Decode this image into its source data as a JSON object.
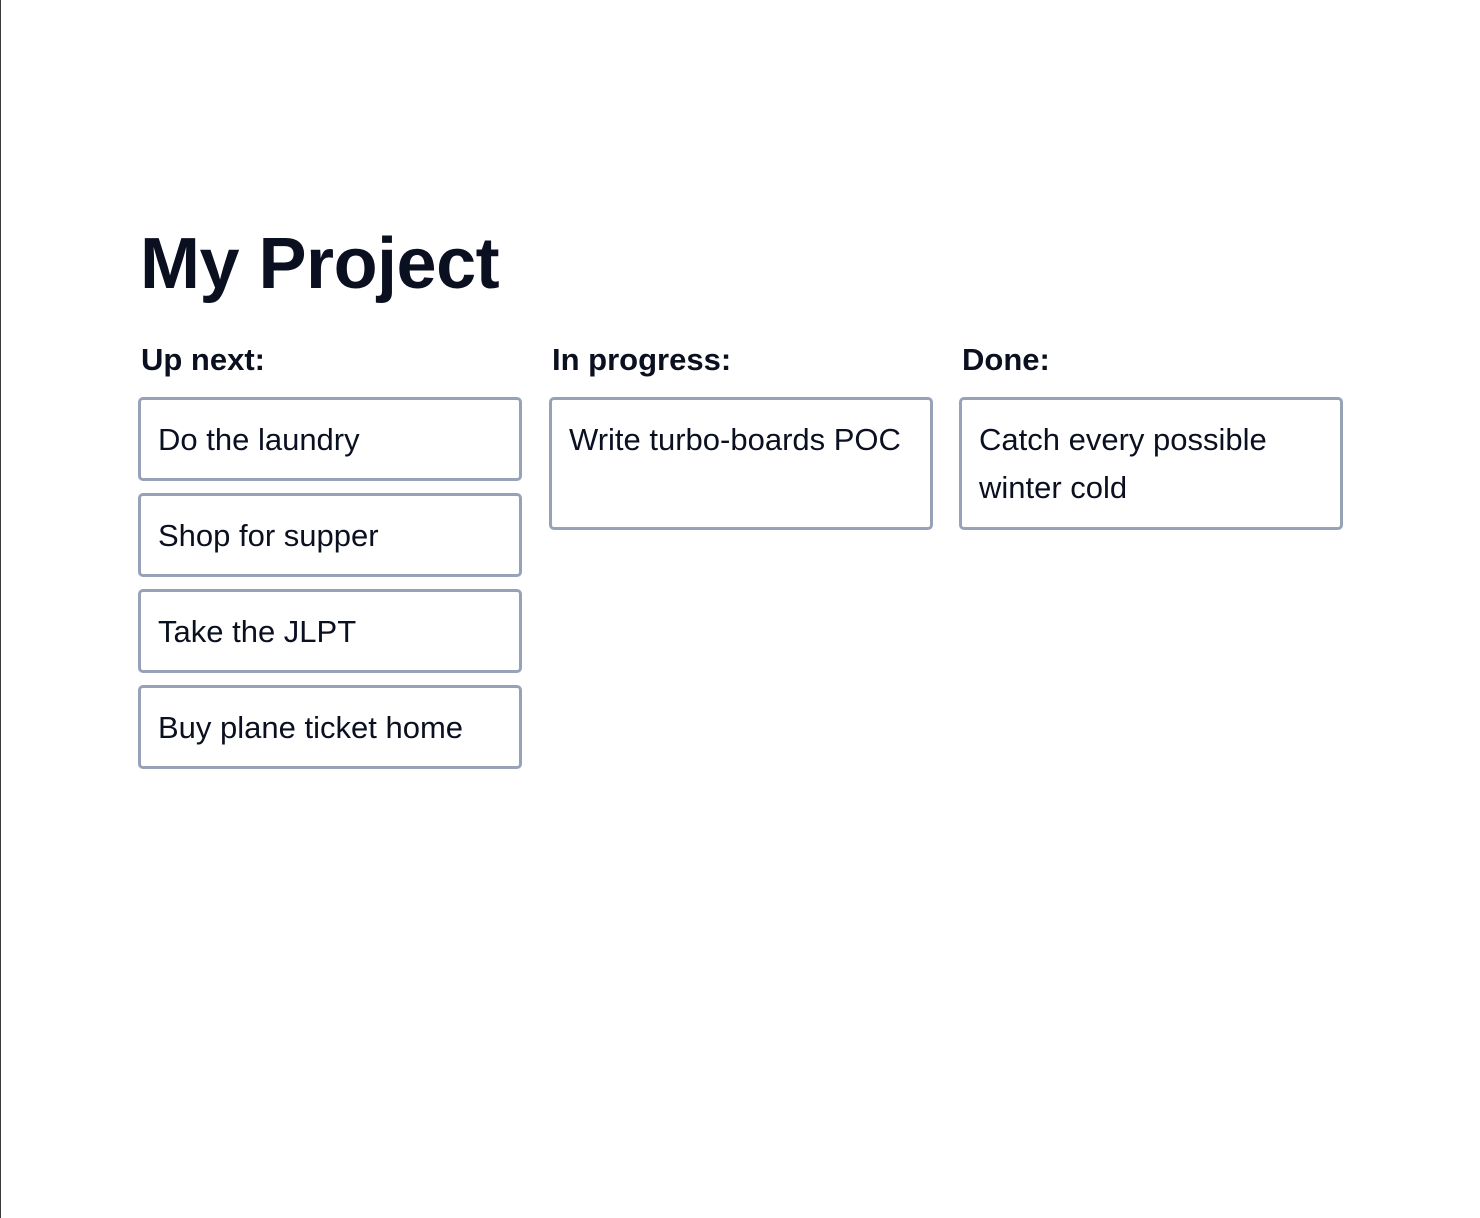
{
  "page": {
    "title": "My Project"
  },
  "columns": [
    {
      "title": "Up next:",
      "cards": [
        {
          "text": "Do the laundry"
        },
        {
          "text": "Shop for supper"
        },
        {
          "text": "Take the JLPT"
        },
        {
          "text": "Buy plane ticket home"
        }
      ]
    },
    {
      "title": "In progress:",
      "cards": [
        {
          "text": "Write turbo-boards POC"
        }
      ]
    },
    {
      "title": "Done:",
      "cards": [
        {
          "text": "Catch every possible winter cold"
        }
      ]
    }
  ],
  "colors": {
    "text": "#0b1020",
    "card_border": "#98a2b7",
    "background": "#ffffff"
  }
}
